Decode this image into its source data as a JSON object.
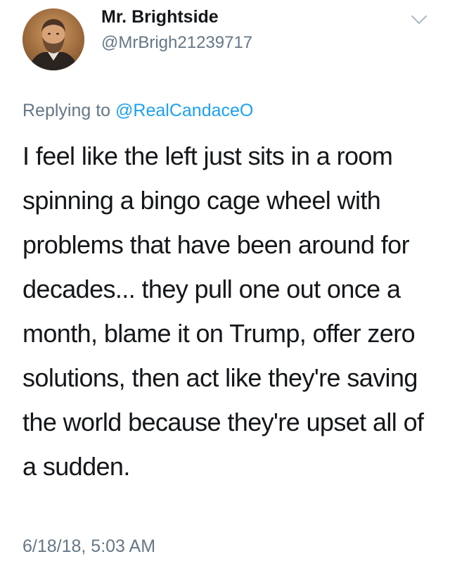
{
  "user": {
    "display_name": "Mr. Brightside",
    "handle": "@MrBrigh21239717",
    "avatar_icon": "portrait-avatar"
  },
  "menu": {
    "icon": "chevron-down-icon"
  },
  "reply": {
    "prefix": "Replying to ",
    "mention": "@RealCandaceO"
  },
  "tweet": {
    "text": "I feel like the left just sits in a room spinning a bingo cage wheel with problems that have been around for decades... they pull one out once a month, blame it on Trump, offer zero solutions, then act like they're saving the world because they're upset all of a sudden.",
    "timestamp": "6/18/18, 5:03 AM"
  },
  "colors": {
    "text": "#14171a",
    "secondary": "#657786",
    "link": "#1da1f2"
  }
}
